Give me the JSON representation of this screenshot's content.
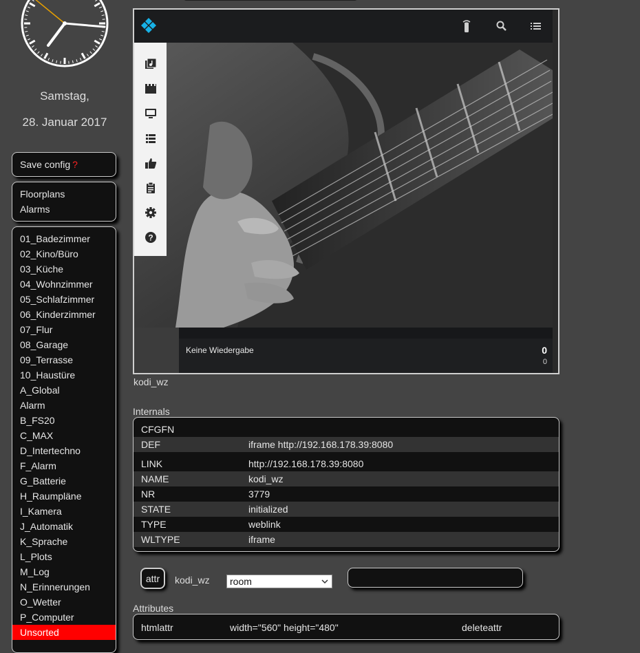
{
  "sidebar": {
    "date_weekday": "Samstag,",
    "date_full": "28. Januar 2017",
    "save_config": "Save config",
    "save_config_marker": "?",
    "nav": [
      "Floorplans",
      "Alarms"
    ],
    "rooms": [
      "01_Badezimmer",
      "02_Kino/Büro",
      "03_Küche",
      "04_Wohnzimmer",
      "05_Schlafzimmer",
      "06_Kinderzimmer",
      "07_Flur",
      "08_Garage",
      "09_Terrasse",
      "10_Haustüre",
      "A_Global",
      "Alarm",
      "B_FS20",
      "C_MAX",
      "D_Intertechno",
      "F_Alarm",
      "G_Batterie",
      "H_Raumpläne",
      "I_Kamera",
      "J_Automatik",
      "K_Sprache",
      "L_Plots",
      "M_Log",
      "N_Erinnerungen",
      "O_Wetter",
      "P_Computer",
      "Unsorted"
    ],
    "active_room": "Unsorted"
  },
  "kodi": {
    "header_icons": [
      "remote-icon",
      "search-icon",
      "list-menu-icon"
    ],
    "sidebar_icons": [
      "music-library-icon",
      "movies-icon",
      "tv-icon",
      "playlist-icon",
      "thumbs-up-icon",
      "clipboard-icon",
      "settings-icon",
      "help-icon"
    ],
    "now_playing": "Keine Wiedergabe",
    "counter_big": "0",
    "counter_small": "0",
    "accent_color": "#17b2e7"
  },
  "device_name": "kodi_wz",
  "internals": {
    "title": "Internals",
    "rows": [
      {
        "key": "CFGFN",
        "value": ""
      },
      {
        "key": "DEF",
        "value": "iframe http://192.168.178.39:8080"
      },
      {
        "key": "LINK",
        "value": "http://192.168.178.39:8080"
      },
      {
        "key": "NAME",
        "value": "kodi_wz"
      },
      {
        "key": "NR",
        "value": "3779"
      },
      {
        "key": "STATE",
        "value": "initialized"
      },
      {
        "key": "TYPE",
        "value": "weblink"
      },
      {
        "key": "WLTYPE",
        "value": "iframe"
      }
    ]
  },
  "attr_form": {
    "button_label": "attr",
    "device": "kodi_wz",
    "selected_attribute": "room",
    "value": ""
  },
  "attributes": {
    "title": "Attributes",
    "rows": [
      {
        "name": "htmlattr",
        "value": "width=\"560\" height=\"480\"",
        "action": "deleteattr"
      }
    ]
  }
}
